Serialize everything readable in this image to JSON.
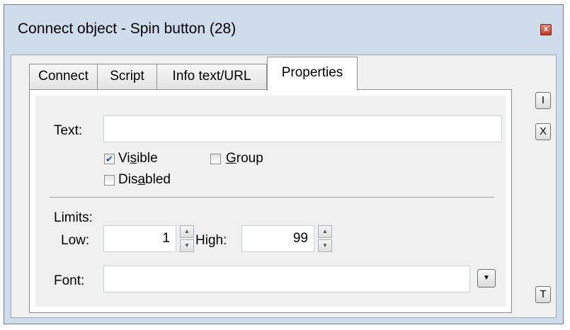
{
  "window": {
    "title": "Connect object - Spin button (28)",
    "close_glyph": "x"
  },
  "tabs": [
    {
      "label": "Connect"
    },
    {
      "label": "Script"
    },
    {
      "label": "Info text/URL"
    },
    {
      "label": "Properties"
    }
  ],
  "active_tab": "Properties",
  "properties": {
    "text_label": "Text:",
    "text_value": "",
    "visible": {
      "label_pre": "Vi",
      "label_ul": "s",
      "label_post": "ible",
      "checked": true
    },
    "group": {
      "label_pre": "",
      "label_ul": "G",
      "label_post": "roup",
      "checked": false
    },
    "disabled": {
      "label_pre": "Dis",
      "label_ul": "a",
      "label_post": "bled",
      "checked": false
    },
    "limits_label": "Limits:",
    "low_label": "Low:",
    "low_value": "1",
    "high_label": "High:",
    "high_value": "99",
    "font_label": "Font:",
    "font_value": ""
  },
  "side_buttons": {
    "i": "I",
    "x": "X",
    "t": "T"
  },
  "icons": {
    "check": "✔",
    "up": "▲",
    "down": "▼"
  }
}
